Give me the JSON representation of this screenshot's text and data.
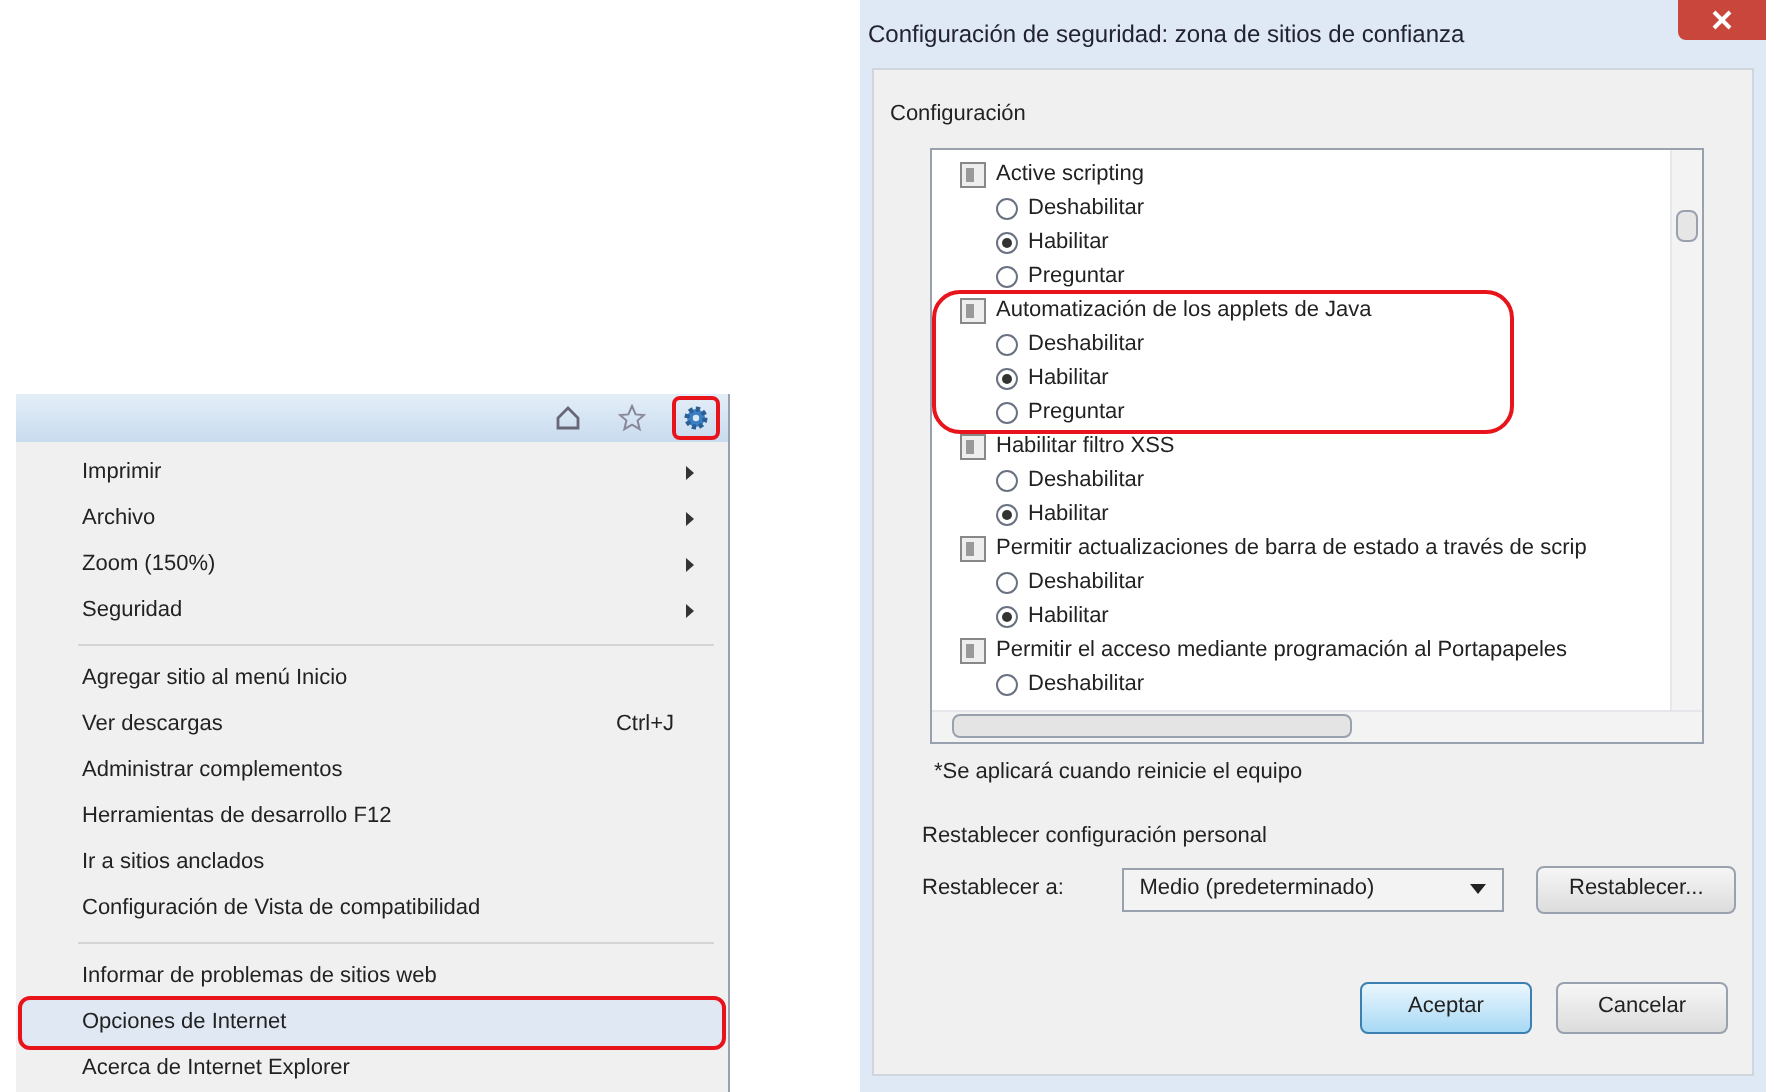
{
  "browser_menu": {
    "toolbar_icons": [
      {
        "kind": "home",
        "highlighted": false
      },
      {
        "kind": "star",
        "highlighted": false
      },
      {
        "kind": "gear",
        "highlighted": true
      }
    ],
    "groups": [
      [
        {
          "label": "Imprimir",
          "submenu": true,
          "highlighted": false,
          "selected": false
        },
        {
          "label": "Archivo",
          "submenu": true,
          "highlighted": false,
          "selected": false
        },
        {
          "label": "Zoom (150%)",
          "submenu": true,
          "highlighted": false,
          "selected": false
        },
        {
          "label": "Seguridad",
          "submenu": true,
          "highlighted": false,
          "selected": false
        }
      ],
      [
        {
          "label": "Agregar sitio al menú Inicio",
          "submenu": false,
          "highlighted": false,
          "selected": false
        },
        {
          "label": "Ver descargas",
          "shortcut": "Ctrl+J",
          "submenu": false,
          "highlighted": false,
          "selected": false
        },
        {
          "label": "Administrar complementos",
          "submenu": false,
          "highlighted": false,
          "selected": false
        },
        {
          "label": "Herramientas de desarrollo F12",
          "submenu": false,
          "highlighted": false,
          "selected": false
        },
        {
          "label": "Ir a sitios anclados",
          "submenu": false,
          "highlighted": false,
          "selected": false
        },
        {
          "label": "Configuración de Vista de compatibilidad",
          "submenu": false,
          "highlighted": false,
          "selected": false
        }
      ],
      [
        {
          "label": "Informar de problemas de sitios web",
          "submenu": false,
          "highlighted": false,
          "selected": false
        },
        {
          "label": "Opciones de Internet",
          "submenu": false,
          "highlighted": true,
          "selected": true
        },
        {
          "label": "Acerca de Internet Explorer",
          "submenu": false,
          "highlighted": false,
          "selected": false
        }
      ]
    ]
  },
  "dialog": {
    "title": "Configuración de seguridad: zona de sitios de confianza",
    "group_label": "Configuración",
    "settings": [
      {
        "label": "Active scripting",
        "highlighted": false,
        "options": [
          {
            "label": "Deshabilitar",
            "selected": false
          },
          {
            "label": "Habilitar",
            "selected": true
          },
          {
            "label": "Preguntar",
            "selected": false
          }
        ]
      },
      {
        "label": "Automatización de los applets de Java",
        "highlighted": true,
        "options": [
          {
            "label": "Deshabilitar",
            "selected": false
          },
          {
            "label": "Habilitar",
            "selected": true
          },
          {
            "label": "Preguntar",
            "selected": false
          }
        ]
      },
      {
        "label": "Habilitar filtro XSS",
        "highlighted": false,
        "options": [
          {
            "label": "Deshabilitar",
            "selected": false
          },
          {
            "label": "Habilitar",
            "selected": true
          }
        ]
      },
      {
        "label": "Permitir actualizaciones de barra de estado a través de scrip",
        "highlighted": false,
        "options": [
          {
            "label": "Deshabilitar",
            "selected": false
          },
          {
            "label": "Habilitar",
            "selected": true
          }
        ]
      },
      {
        "label": "Permitir el acceso mediante programación al Portapapeles",
        "highlighted": false,
        "options": [
          {
            "label": "Deshabilitar",
            "selected": false
          }
        ]
      }
    ],
    "note": "*Se aplicará cuando reinicie el equipo",
    "reset_section": "Restablecer configuración personal",
    "reset_label": "Restablecer a:",
    "reset_value": "Medio (predeterminado)",
    "reset_button": "Restablecer...",
    "ok_button": "Aceptar",
    "cancel_button": "Cancelar"
  }
}
